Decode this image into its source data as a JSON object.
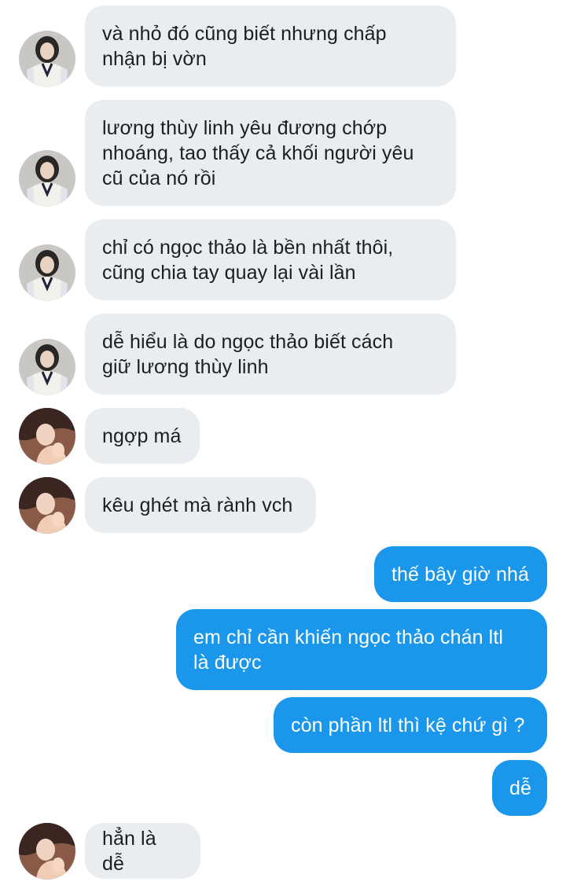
{
  "conversation": {
    "messages": [
      {
        "sender": "contact_a",
        "text": "và nhỏ đó cũng biết nhưng chấp\nnhận bị vờn"
      },
      {
        "sender": "contact_a",
        "text": "lương thùy linh yêu đương chớp\nnhoáng, tao thấy cả khối người yêu\ncũ của nó rồi"
      },
      {
        "sender": "contact_a",
        "text": "chỉ có ngọc thảo là bền nhất thôi,\ncũng chia tay quay lại vài lần"
      },
      {
        "sender": "contact_a",
        "text": "dễ hiểu là do ngọc thảo biết cách\ngiữ lương thùy linh"
      },
      {
        "sender": "contact_b",
        "text": "ngợp má"
      },
      {
        "sender": "contact_b",
        "text": "kêu ghét mà rành vch"
      },
      {
        "sender": "me",
        "text": "thế bây giờ nhá"
      },
      {
        "sender": "me",
        "text": "em chỉ cần khiến ngọc thảo chán ltl\nlà được"
      },
      {
        "sender": "me",
        "text": "còn phần ltl thì kệ chứ gì ?"
      },
      {
        "sender": "me",
        "text": "dễ"
      },
      {
        "sender": "contact_b",
        "text": "hẳn là dễ"
      }
    ]
  },
  "colors": {
    "incoming_bubble": "#e9ecf0",
    "outgoing_bubble": "#1a97ea",
    "incoming_text": "#1c1e21",
    "outgoing_text": "#ffffff"
  }
}
